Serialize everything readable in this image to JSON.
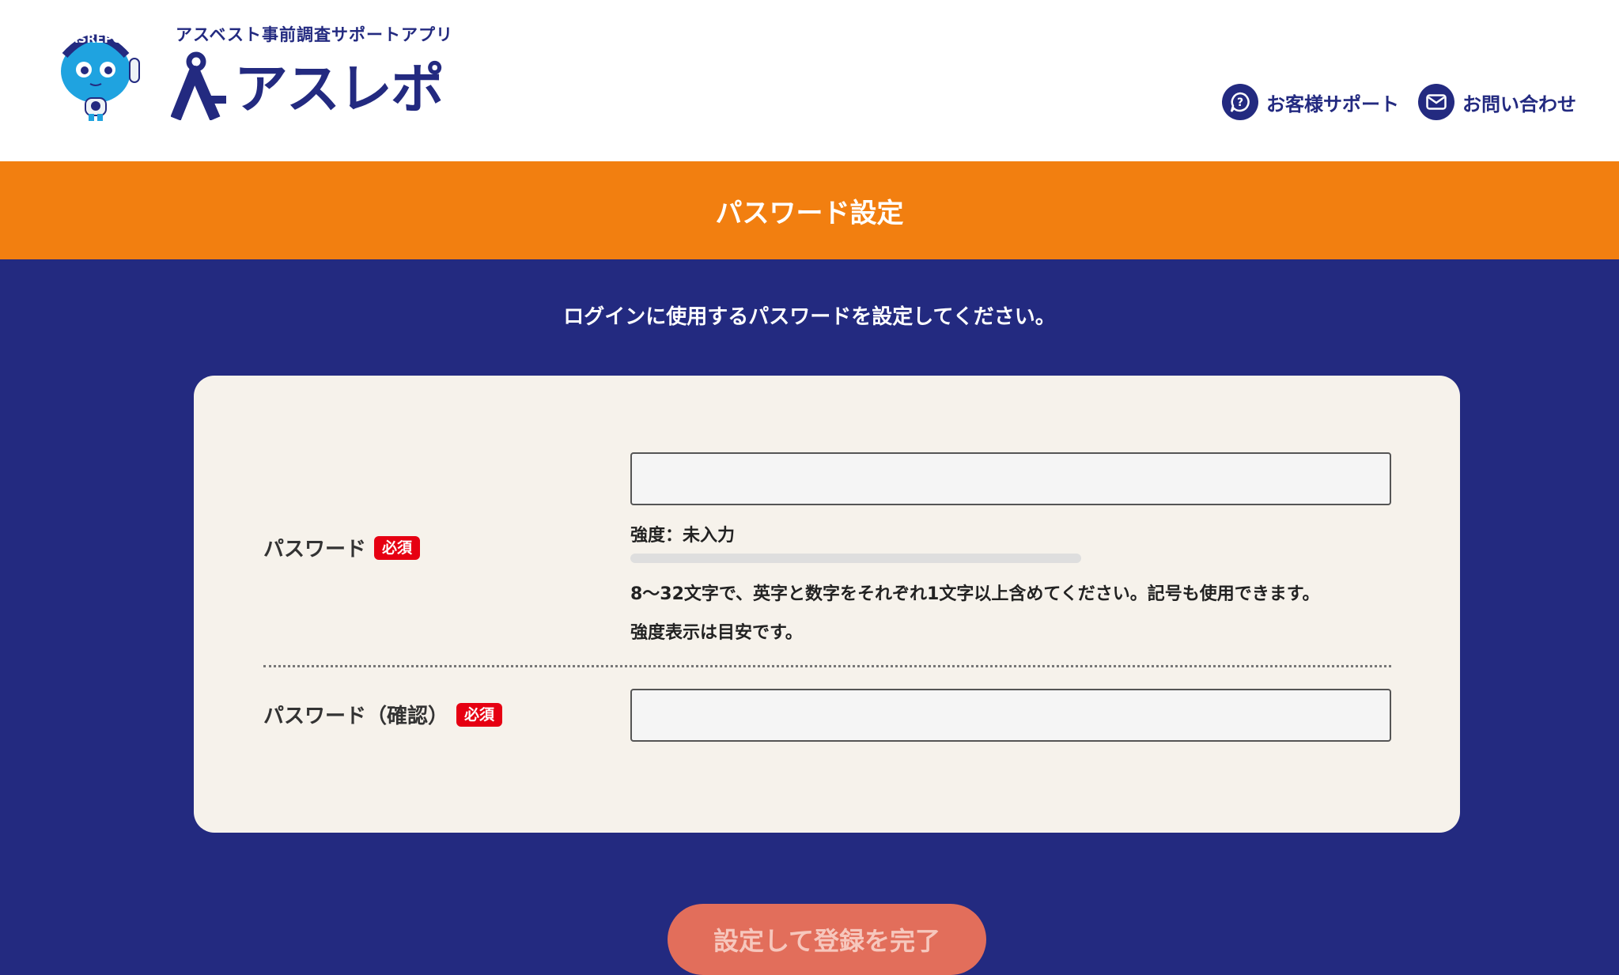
{
  "header": {
    "tagline": "アスベスト事前調査サポートアプリ",
    "logo_text": "アスレポ",
    "mascot_label": "ASREPO",
    "support_link": "お客様サポート",
    "contact_link": "お問い合わせ"
  },
  "page_title": "パスワード設定",
  "instruction": "ログインに使用するパスワードを設定してください。",
  "form": {
    "password": {
      "label": "パスワード",
      "required_badge": "必須",
      "value": "",
      "strength_text": "強度：未入力",
      "strength_level": 0,
      "hint_1": "8〜32文字で、英字と数字をそれぞれ1文字以上含めてください。記号も使用できます。",
      "hint_2": "強度表示は目安です。"
    },
    "password_confirm": {
      "label": "パスワード（確認）",
      "required_badge": "必須",
      "value": ""
    },
    "submit_label": "設定して登録を完了"
  },
  "colors": {
    "navy": "#232a80",
    "orange": "#f27f10",
    "card_bg": "#f6f2eb",
    "required_red": "#e60012",
    "button_disabled": "#e26e5b"
  },
  "icons": {
    "support": "question-chat-icon",
    "contact": "envelope-icon"
  }
}
